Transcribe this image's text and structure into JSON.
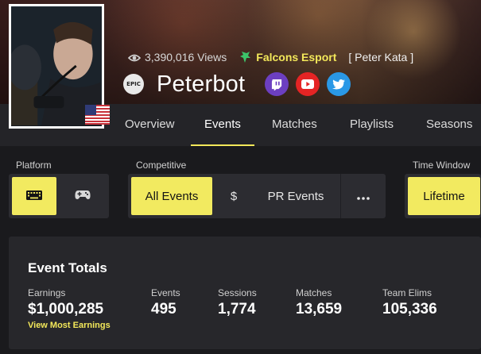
{
  "profile": {
    "views": "3,390,016 Views",
    "team": "Falcons Esport",
    "real_name": "[ Peter Kata ]",
    "name": "Peterbot",
    "epic_label": "EPIC",
    "country": "United States",
    "socials": [
      "twitch-icon",
      "youtube-icon",
      "twitter-icon"
    ]
  },
  "nav": {
    "tabs": [
      "Overview",
      "Events",
      "Matches",
      "Playlists",
      "Seasons"
    ],
    "active": "Events"
  },
  "filters": {
    "platform": {
      "label": "Platform",
      "options": [
        "keyboard-icon",
        "gamepad-icon"
      ],
      "selected": "keyboard-icon"
    },
    "competitive": {
      "label": "Competitive",
      "options": [
        "All Events",
        "$",
        "PR Events"
      ],
      "selected": "All Events",
      "more": "more-icon"
    },
    "time_window": {
      "label": "Time Window",
      "selected": "Lifetime"
    }
  },
  "totals": {
    "title": "Event Totals",
    "earnings_label": "Earnings",
    "earnings": "$1,000,285",
    "earnings_link": "View Most Earnings",
    "events_label": "Events",
    "events": "495",
    "sessions_label": "Sessions",
    "sessions": "1,774",
    "matches_label": "Matches",
    "matches": "13,659",
    "elims_label": "Team Elims",
    "elims": "105,336"
  },
  "colors": {
    "accent": "#f3e85a",
    "twitch": "#6c3fc1",
    "youtube": "#e52424",
    "twitter": "#2a98e6"
  }
}
